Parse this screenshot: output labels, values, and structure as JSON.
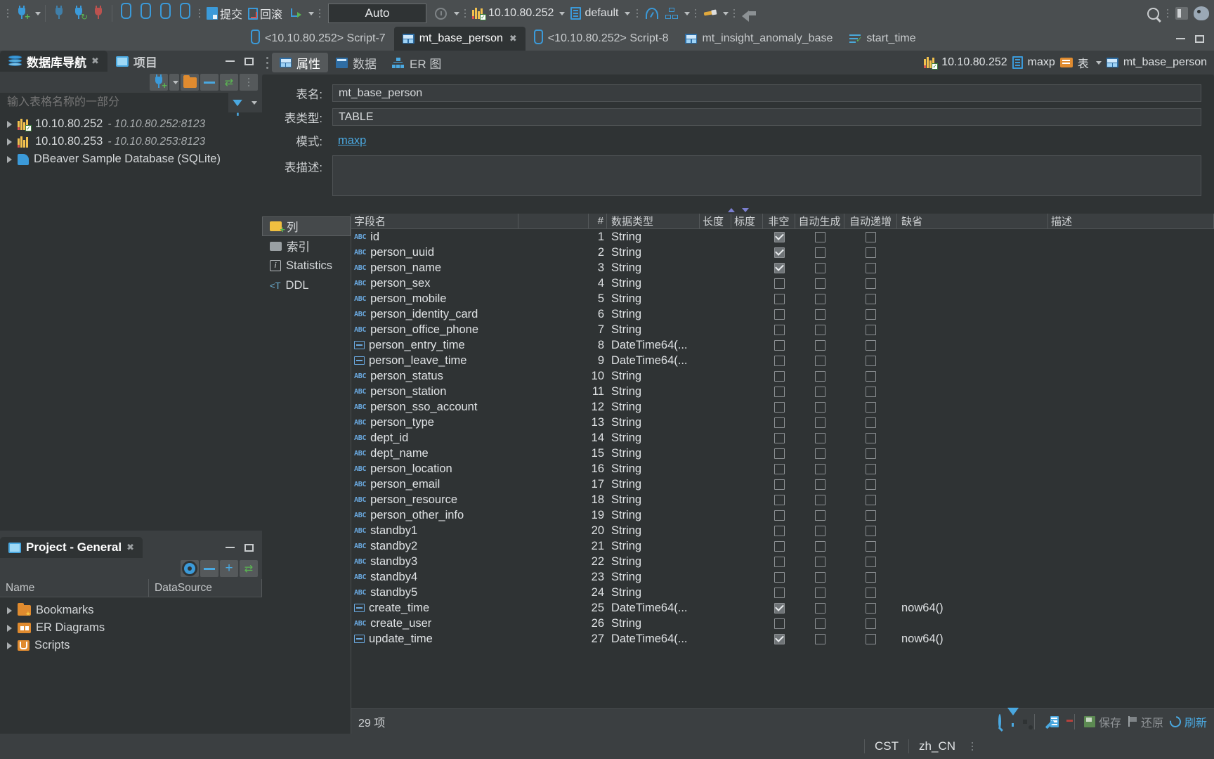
{
  "toolbar": {
    "auto_commit_value": "Auto",
    "connection": "10.10.80.252",
    "schema": "default",
    "buttons": [
      {
        "name": "new-connection",
        "icon": "plug-plus-icon"
      },
      {
        "name": "disconnect",
        "icon": "plug-icon"
      },
      {
        "name": "reconnect",
        "icon": "plug-refresh-icon"
      },
      {
        "name": "invalidate",
        "icon": "plug-disconnect-icon"
      },
      {
        "name": "sql-editor",
        "icon": "sql-script-icon"
      },
      {
        "name": "sql-editor-open",
        "icon": "sql-script-open-icon"
      },
      {
        "name": "sql-editor-new",
        "icon": "sql-script-new-icon"
      },
      {
        "name": "sql-editor-recent",
        "icon": "sql-script-search-icon"
      }
    ],
    "commit_label": "提交",
    "rollback_label": "回滚"
  },
  "editor_tabs": [
    {
      "label": "<10.10.80.252> Script-7",
      "icon": "sql-script-icon",
      "active": false,
      "closable": false
    },
    {
      "label": "mt_base_person",
      "icon": "table-icon",
      "active": true,
      "closable": true
    },
    {
      "label": "<10.10.80.252> Script-8",
      "icon": "sql-script-icon",
      "active": false,
      "closable": false
    },
    {
      "label": "mt_insight_anomaly_base",
      "icon": "table-icon",
      "active": false,
      "closable": false
    },
    {
      "label": "start_time",
      "icon": "rows-check-icon",
      "active": false,
      "closable": false
    }
  ],
  "navigator": {
    "tabs": [
      {
        "label": "数据库导航",
        "icon": "database-nav-icon",
        "active": true,
        "closable": true
      },
      {
        "label": "项目",
        "icon": "project-icon",
        "active": false,
        "closable": false
      }
    ],
    "filter_placeholder": "输入表格名称的一部分",
    "filter_value": "",
    "tree": [
      {
        "label": "10.10.80.252",
        "sub": "- 10.10.80.252:8123",
        "icon": "db-connected-icon"
      },
      {
        "label": "10.10.80.253",
        "sub": "- 10.10.80.253:8123",
        "icon": "db-icon"
      },
      {
        "label": "DBeaver Sample Database (SQLite)",
        "sub": "",
        "icon": "sqlite-icon"
      }
    ]
  },
  "project": {
    "tab_label": "Project - General",
    "columns": [
      "Name",
      "DataSource"
    ],
    "items": [
      {
        "label": "Bookmarks",
        "icon": "bookmarks-folder-icon"
      },
      {
        "label": "ER Diagrams",
        "icon": "er-diagrams-folder-icon"
      },
      {
        "label": "Scripts",
        "icon": "scripts-folder-icon"
      }
    ]
  },
  "object_editor": {
    "tabs": [
      {
        "label": "属性",
        "icon": "properties-icon",
        "active": true
      },
      {
        "label": "数据",
        "icon": "data-icon",
        "active": false
      },
      {
        "label": "ER 图",
        "icon": "er-diagram-icon",
        "active": false
      }
    ],
    "breadcrumb": [
      {
        "label": "10.10.80.252",
        "icon": "db-connected-icon"
      },
      {
        "label": "maxp",
        "icon": "schema-icon"
      },
      {
        "label": "表",
        "icon": "tables-folder-icon",
        "dropdown": true
      },
      {
        "label": "mt_base_person",
        "icon": "table-icon"
      }
    ],
    "form": {
      "name_label": "表名:",
      "name_value": "mt_base_person",
      "type_label": "表类型:",
      "type_value": "TABLE",
      "schema_label": "模式:",
      "schema_value": "maxp",
      "desc_label": "表描述:",
      "desc_value": ""
    },
    "side_nav": [
      {
        "label": "列",
        "icon": "columns-icon",
        "active": true
      },
      {
        "label": "索引",
        "icon": "index-icon",
        "active": false
      },
      {
        "label": "Statistics",
        "icon": "statistics-icon",
        "active": false
      },
      {
        "label": "DDL",
        "icon": "ddl-icon",
        "active": false
      }
    ]
  },
  "columns_grid": {
    "headers": {
      "name": "字段名",
      "blank": "",
      "num": "#",
      "type": "数据类型",
      "length": "长度",
      "scale": "标度",
      "notnull": "非空",
      "autogen": "自动生成",
      "autoincr": "自动递增",
      "default": "缺省",
      "description": "描述"
    },
    "rows": [
      {
        "icon": "abc",
        "name": "id",
        "num": 1,
        "type": "String",
        "length": "",
        "scale": "",
        "notnull": true,
        "autogen": false,
        "autoincr": false,
        "default": "",
        "desc": ""
      },
      {
        "icon": "abc",
        "name": "person_uuid",
        "num": 2,
        "type": "String",
        "length": "",
        "scale": "",
        "notnull": true,
        "autogen": false,
        "autoincr": false,
        "default": "",
        "desc": ""
      },
      {
        "icon": "abc",
        "name": "person_name",
        "num": 3,
        "type": "String",
        "length": "",
        "scale": "",
        "notnull": true,
        "autogen": false,
        "autoincr": false,
        "default": "",
        "desc": ""
      },
      {
        "icon": "abc",
        "name": "person_sex",
        "num": 4,
        "type": "String",
        "length": "",
        "scale": "",
        "notnull": false,
        "autogen": false,
        "autoincr": false,
        "default": "",
        "desc": ""
      },
      {
        "icon": "abc",
        "name": "person_mobile",
        "num": 5,
        "type": "String",
        "length": "",
        "scale": "",
        "notnull": false,
        "autogen": false,
        "autoincr": false,
        "default": "",
        "desc": ""
      },
      {
        "icon": "abc",
        "name": "person_identity_card",
        "num": 6,
        "type": "String",
        "length": "",
        "scale": "",
        "notnull": false,
        "autogen": false,
        "autoincr": false,
        "default": "",
        "desc": ""
      },
      {
        "icon": "abc",
        "name": "person_office_phone",
        "num": 7,
        "type": "String",
        "length": "",
        "scale": "",
        "notnull": false,
        "autogen": false,
        "autoincr": false,
        "default": "",
        "desc": ""
      },
      {
        "icon": "datetime",
        "name": "person_entry_time",
        "num": 8,
        "type": "DateTime64(...",
        "length": "",
        "scale": "",
        "notnull": false,
        "autogen": false,
        "autoincr": false,
        "default": "",
        "desc": ""
      },
      {
        "icon": "datetime",
        "name": "person_leave_time",
        "num": 9,
        "type": "DateTime64(...",
        "length": "",
        "scale": "",
        "notnull": false,
        "autogen": false,
        "autoincr": false,
        "default": "",
        "desc": ""
      },
      {
        "icon": "abc",
        "name": "person_status",
        "num": 10,
        "type": "String",
        "length": "",
        "scale": "",
        "notnull": false,
        "autogen": false,
        "autoincr": false,
        "default": "",
        "desc": ""
      },
      {
        "icon": "abc",
        "name": "person_station",
        "num": 11,
        "type": "String",
        "length": "",
        "scale": "",
        "notnull": false,
        "autogen": false,
        "autoincr": false,
        "default": "",
        "desc": ""
      },
      {
        "icon": "abc",
        "name": "person_sso_account",
        "num": 12,
        "type": "String",
        "length": "",
        "scale": "",
        "notnull": false,
        "autogen": false,
        "autoincr": false,
        "default": "",
        "desc": ""
      },
      {
        "icon": "abc",
        "name": "person_type",
        "num": 13,
        "type": "String",
        "length": "",
        "scale": "",
        "notnull": false,
        "autogen": false,
        "autoincr": false,
        "default": "",
        "desc": ""
      },
      {
        "icon": "abc",
        "name": "dept_id",
        "num": 14,
        "type": "String",
        "length": "",
        "scale": "",
        "notnull": false,
        "autogen": false,
        "autoincr": false,
        "default": "",
        "desc": ""
      },
      {
        "icon": "abc",
        "name": "dept_name",
        "num": 15,
        "type": "String",
        "length": "",
        "scale": "",
        "notnull": false,
        "autogen": false,
        "autoincr": false,
        "default": "",
        "desc": ""
      },
      {
        "icon": "abc",
        "name": "person_location",
        "num": 16,
        "type": "String",
        "length": "",
        "scale": "",
        "notnull": false,
        "autogen": false,
        "autoincr": false,
        "default": "",
        "desc": ""
      },
      {
        "icon": "abc",
        "name": "person_email",
        "num": 17,
        "type": "String",
        "length": "",
        "scale": "",
        "notnull": false,
        "autogen": false,
        "autoincr": false,
        "default": "",
        "desc": ""
      },
      {
        "icon": "abc",
        "name": "person_resource",
        "num": 18,
        "type": "String",
        "length": "",
        "scale": "",
        "notnull": false,
        "autogen": false,
        "autoincr": false,
        "default": "",
        "desc": ""
      },
      {
        "icon": "abc",
        "name": "person_other_info",
        "num": 19,
        "type": "String",
        "length": "",
        "scale": "",
        "notnull": false,
        "autogen": false,
        "autoincr": false,
        "default": "",
        "desc": ""
      },
      {
        "icon": "abc",
        "name": "standby1",
        "num": 20,
        "type": "String",
        "length": "",
        "scale": "",
        "notnull": false,
        "autogen": false,
        "autoincr": false,
        "default": "",
        "desc": ""
      },
      {
        "icon": "abc",
        "name": "standby2",
        "num": 21,
        "type": "String",
        "length": "",
        "scale": "",
        "notnull": false,
        "autogen": false,
        "autoincr": false,
        "default": "",
        "desc": ""
      },
      {
        "icon": "abc",
        "name": "standby3",
        "num": 22,
        "type": "String",
        "length": "",
        "scale": "",
        "notnull": false,
        "autogen": false,
        "autoincr": false,
        "default": "",
        "desc": ""
      },
      {
        "icon": "abc",
        "name": "standby4",
        "num": 23,
        "type": "String",
        "length": "",
        "scale": "",
        "notnull": false,
        "autogen": false,
        "autoincr": false,
        "default": "",
        "desc": ""
      },
      {
        "icon": "abc",
        "name": "standby5",
        "num": 24,
        "type": "String",
        "length": "",
        "scale": "",
        "notnull": false,
        "autogen": false,
        "autoincr": false,
        "default": "",
        "desc": ""
      },
      {
        "icon": "datetime",
        "name": "create_time",
        "num": 25,
        "type": "DateTime64(...",
        "length": "",
        "scale": "",
        "notnull": true,
        "autogen": false,
        "autoincr": false,
        "default": "now64()",
        "desc": ""
      },
      {
        "icon": "abc",
        "name": "create_user",
        "num": 26,
        "type": "String",
        "length": "",
        "scale": "",
        "notnull": false,
        "autogen": false,
        "autoincr": false,
        "default": "",
        "desc": ""
      },
      {
        "icon": "datetime",
        "name": "update_time",
        "num": 27,
        "type": "DateTime64(...",
        "length": "",
        "scale": "",
        "notnull": true,
        "autogen": false,
        "autoincr": false,
        "default": "now64()",
        "desc": ""
      },
      {
        "icon": "abc",
        "name": "",
        "num": "",
        "type": "",
        "length": "",
        "scale": "",
        "notnull": false,
        "autogen": false,
        "autoincr": false,
        "default": "",
        "desc": ""
      }
    ],
    "status_count": "29 项",
    "actions": [
      {
        "name": "search-button",
        "icon": "search-icon"
      },
      {
        "name": "filter-button",
        "icon": "filter-icon"
      },
      {
        "name": "settings-button",
        "icon": "gear-icon"
      },
      {
        "name": "edit-button",
        "icon": "pencil-icon"
      },
      {
        "name": "add-row-button",
        "icon": "rows-icon"
      },
      {
        "name": "delete-button",
        "icon": "trash-icon"
      }
    ],
    "save_label": "保存",
    "revert_label": "还原",
    "refresh_label": "刷新"
  },
  "statusbar": {
    "timezone": "CST",
    "locale": "zh_CN"
  }
}
